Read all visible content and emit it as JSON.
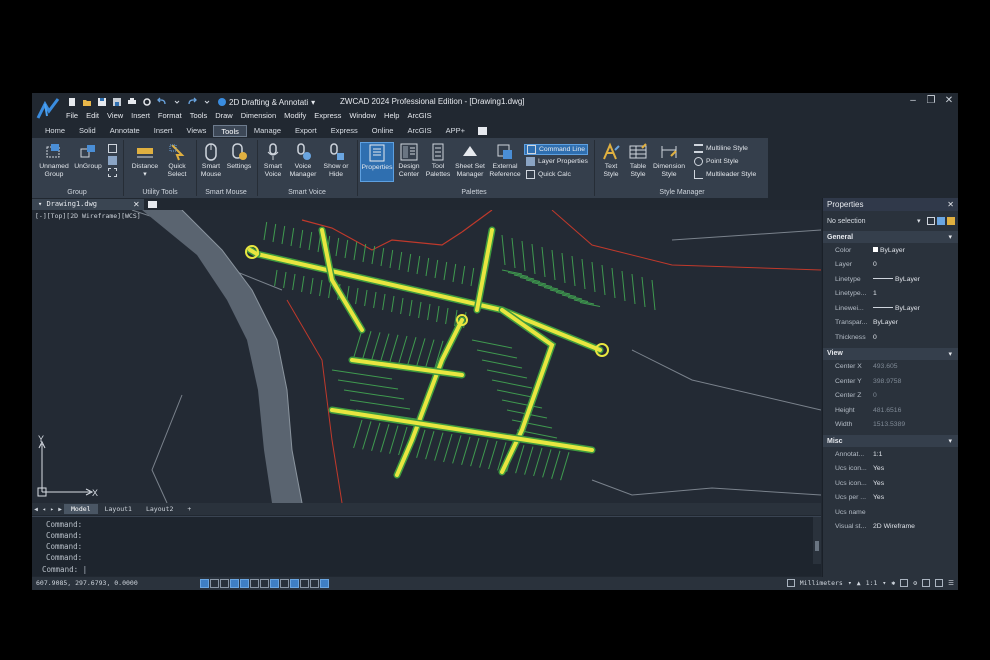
{
  "window": {
    "title": "ZWCAD 2024 Professional Edition - [Drawing1.dwg]",
    "workspace": "2D Drafting & Annotati",
    "controls": [
      "minimize",
      "restore",
      "close"
    ]
  },
  "menu": [
    "File",
    "Edit",
    "View",
    "Insert",
    "Format",
    "Tools",
    "Draw",
    "Dimension",
    "Modify",
    "Express",
    "Window",
    "Help",
    "ArcGIS"
  ],
  "ribbon_tabs": [
    "Home",
    "Solid",
    "Annotate",
    "Insert",
    "Views",
    "Tools",
    "Manage",
    "Export",
    "Express",
    "Online",
    "ArcGIS",
    "APP+"
  ],
  "active_tab": "Tools",
  "ribbon": {
    "group": {
      "label": "Group",
      "unnamed_l1": "Unnamed",
      "unnamed_l2": "Group",
      "ungroup": "UnGroup"
    },
    "utility": {
      "label": "Utility Tools",
      "distance": "Distance",
      "quick_l1": "Quick",
      "quick_l2": "Select"
    },
    "smart_mouse": {
      "label": "Smart Mouse",
      "smart_l1": "Smart",
      "smart_l2": "Mouse",
      "settings": "Settings"
    },
    "smart_voice": {
      "label": "Smart Voice",
      "sv_l1": "Smart",
      "sv_l2": "Voice",
      "vm_l1": "Voice",
      "vm_l2": "Manager",
      "sh_l1": "Show or",
      "sh_l2": "Hide"
    },
    "palettes": {
      "label": "Palettes",
      "properties": "Properties",
      "dc_l1": "Design",
      "dc_l2": "Center",
      "tp_l1": "Tool",
      "tp_l2": "Palettes",
      "ssm_l1": "Sheet Set",
      "ssm_l2": "Manager",
      "er_l1": "External",
      "er_l2": "Reference",
      "command_line": "Command Line",
      "layer_properties": "Layer Properties",
      "quick_calc": "Quick Calc"
    },
    "style_manager": {
      "label": "Style Manager",
      "ts_l1": "Text",
      "ts_l2": "Style",
      "tbs_l1": "Table",
      "tbs_l2": "Style",
      "ds_l1": "Dimension",
      "ds_l2": "Style",
      "multiline": "Multiline Style",
      "point": "Point Style",
      "multileader": "Multileader Style"
    }
  },
  "document_tab": "Drawing1.dwg",
  "viewport_label": "[-][Top][2D Wireframe][WCS]",
  "ucs": {
    "x": "X",
    "y": "Y"
  },
  "layout_tabs": [
    "Model",
    "Layout1",
    "Layout2",
    "+"
  ],
  "command": {
    "history": [
      "Command:",
      "Command:",
      "Command:",
      "Command:"
    ],
    "prompt": "Command:"
  },
  "status": {
    "coords": "607.9085, 297.6793, 0.0000",
    "units": "Millimeters",
    "scale": "1:1"
  },
  "properties": {
    "title": "Properties",
    "selection": "No selection",
    "sections": [
      {
        "name": "General",
        "rows": [
          {
            "k": "Color",
            "v": "ByLayer"
          },
          {
            "k": "Layer",
            "v": "0"
          },
          {
            "k": "Linetype",
            "v": "ByLayer"
          },
          {
            "k": "Linetype...",
            "v": "1"
          },
          {
            "k": "Linewei...",
            "v": "ByLayer"
          },
          {
            "k": "Transpar...",
            "v": "ByLayer"
          },
          {
            "k": "Thickness",
            "v": "0"
          }
        ]
      },
      {
        "name": "View",
        "rows": [
          {
            "k": "Center X",
            "v": "493.605"
          },
          {
            "k": "Center Y",
            "v": "398.9758"
          },
          {
            "k": "Center Z",
            "v": "0"
          },
          {
            "k": "Height",
            "v": "481.6516"
          },
          {
            "k": "Width",
            "v": "1513.5389"
          }
        ]
      },
      {
        "name": "Misc",
        "rows": [
          {
            "k": "Annotat...",
            "v": "1:1"
          },
          {
            "k": "Ucs icon...",
            "v": "Yes"
          },
          {
            "k": "Ucs icon...",
            "v": "Yes"
          },
          {
            "k": "Ucs per ...",
            "v": "Yes"
          },
          {
            "k": "Ucs name",
            "v": ""
          },
          {
            "k": "Visual st...",
            "v": "2D Wireframe"
          }
        ]
      }
    ]
  },
  "colors": {
    "accent": "#2f6fb0",
    "road": "#e8e640",
    "road_edge": "#3f9a3f",
    "lot": "#4a9a5a",
    "river": "#5a6470",
    "boundary": "#c0392b"
  }
}
